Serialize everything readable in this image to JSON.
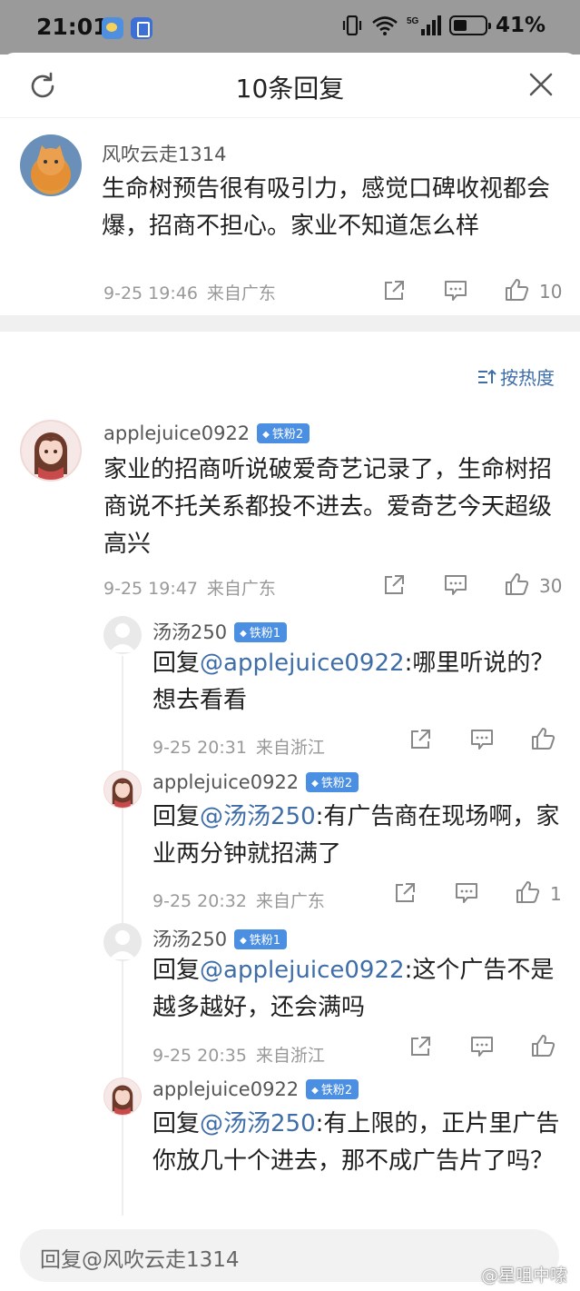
{
  "status_bar": {
    "time": "21:01",
    "battery": "41%"
  },
  "header": {
    "title": "10条回复"
  },
  "main_post": {
    "user": "风吹云走1314",
    "text": "生命树预告很有吸引力，感觉口碑收视都会爆，招商不担心。家业不知道怎么样",
    "time": "9-25 19:46",
    "location": "来自广东",
    "likes": "10"
  },
  "sort": {
    "label": "按热度"
  },
  "replies": [
    {
      "user": "applejuice0922",
      "badge": "铁粉2",
      "text": "家业的招商听说破爱奇艺记录了，生命树招商说不托关系都投不进去。爱奇艺今天超级高兴",
      "time": "9-25 19:47",
      "location": "来自广东",
      "likes": "30"
    },
    {
      "user": "汤汤250",
      "badge": "铁粉1",
      "prefix": "回复",
      "mention": "@applejuice0922",
      "text": ":哪里听说的？想去看看",
      "time": "9-25 20:31",
      "location": "来自浙江",
      "likes": ""
    },
    {
      "user": "applejuice0922",
      "badge": "铁粉2",
      "prefix": "回复",
      "mention": "@汤汤250",
      "text": ":有广告商在现场啊，家业两分钟就招满了",
      "time": "9-25 20:32",
      "location": "来自广东",
      "likes": "1"
    },
    {
      "user": "汤汤250",
      "badge": "铁粉1",
      "prefix": "回复",
      "mention": "@applejuice0922",
      "text": ":这个广告不是越多越好，还会满吗",
      "time": "9-25 20:35",
      "location": "来自浙江",
      "likes": ""
    },
    {
      "user": "applejuice0922",
      "badge": "铁粉2",
      "prefix": "回复",
      "mention": "@汤汤250",
      "text": ":有上限的，正片里广告你放几十个进去，那不成广告片了吗？",
      "time": "",
      "location": "",
      "likes": ""
    }
  ],
  "footer": {
    "reply_placeholder": "回复@风吹云走1314"
  },
  "watermark": "@星咀中嗦"
}
